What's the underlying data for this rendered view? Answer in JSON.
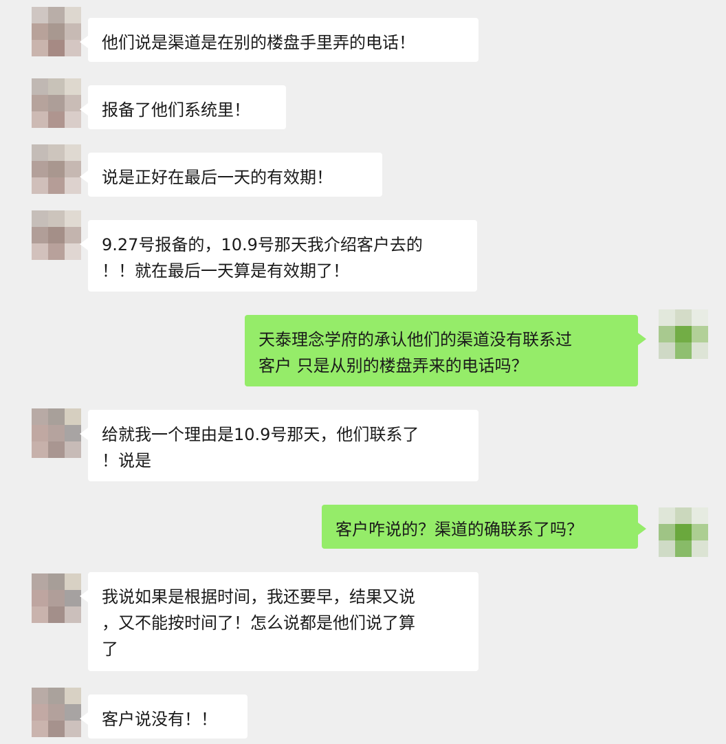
{
  "colors": {
    "background": "#efefef",
    "incoming_bubble": "#ffffff",
    "outgoing_bubble": "#95ec69",
    "text": "#1a1a1a"
  },
  "messages": [
    {
      "side": "incoming",
      "text": "他们说是渠道是在别的楼盘手里弄的电话！"
    },
    {
      "side": "incoming",
      "text": "报备了他们系统里！"
    },
    {
      "side": "incoming",
      "text": "说是正好在最后一天的有效期！"
    },
    {
      "side": "incoming",
      "text": "9.27号报备的，10.9号那天我介绍客户去的\n！！就在最后一天算是有效期了！"
    },
    {
      "side": "outgoing",
      "text": "天泰理念学府的承认他们的渠道没有联系过\n客户 只是从别的楼盘弄来的电话吗？"
    },
    {
      "side": "incoming",
      "text": "给就我一个理由是10.9号那天，他们联系了\n！说是"
    },
    {
      "side": "outgoing",
      "text": "客户咋说的？渠道的确联系了吗？"
    },
    {
      "side": "incoming",
      "text": "我说如果是根据时间，我还要早，结果又说\n，又不能按时间了！怎么说都是他们说了算\n了"
    },
    {
      "side": "incoming",
      "text": "客户说没有！！"
    }
  ]
}
